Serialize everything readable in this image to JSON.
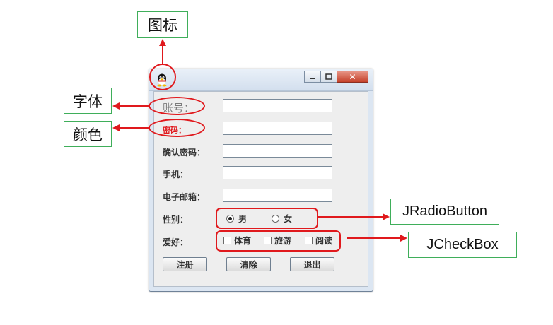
{
  "callouts": {
    "icon": "图标",
    "font": "字体",
    "color": "颜色",
    "radio": "JRadioButton",
    "checkbox": "JCheckBox"
  },
  "window": {
    "controls": {
      "minimize": "▭",
      "maximize": "▢",
      "close": "✕"
    }
  },
  "form": {
    "account_label": "账号：",
    "password_label": "密码：",
    "confirm_label": "确认密码：",
    "phone_label": "手机：",
    "email_label": "电子邮箱：",
    "gender_label": "性别：",
    "hobby_label": "爱好：",
    "account_value": "",
    "password_value": "",
    "confirm_value": "",
    "phone_value": "",
    "email_value": "",
    "gender_options": [
      "男",
      "女"
    ],
    "gender_selected": "男",
    "hobby_options": [
      "体育",
      "旅游",
      "阅读"
    ]
  },
  "buttons": {
    "register": "注册",
    "clear": "清除",
    "exit": "退出"
  },
  "colors": {
    "callout_border": "#3fae5a",
    "annotation_red": "#e0191d",
    "password_label_color": "#e0191d"
  },
  "icons": {
    "app_icon": "qq-penguin-icon"
  }
}
